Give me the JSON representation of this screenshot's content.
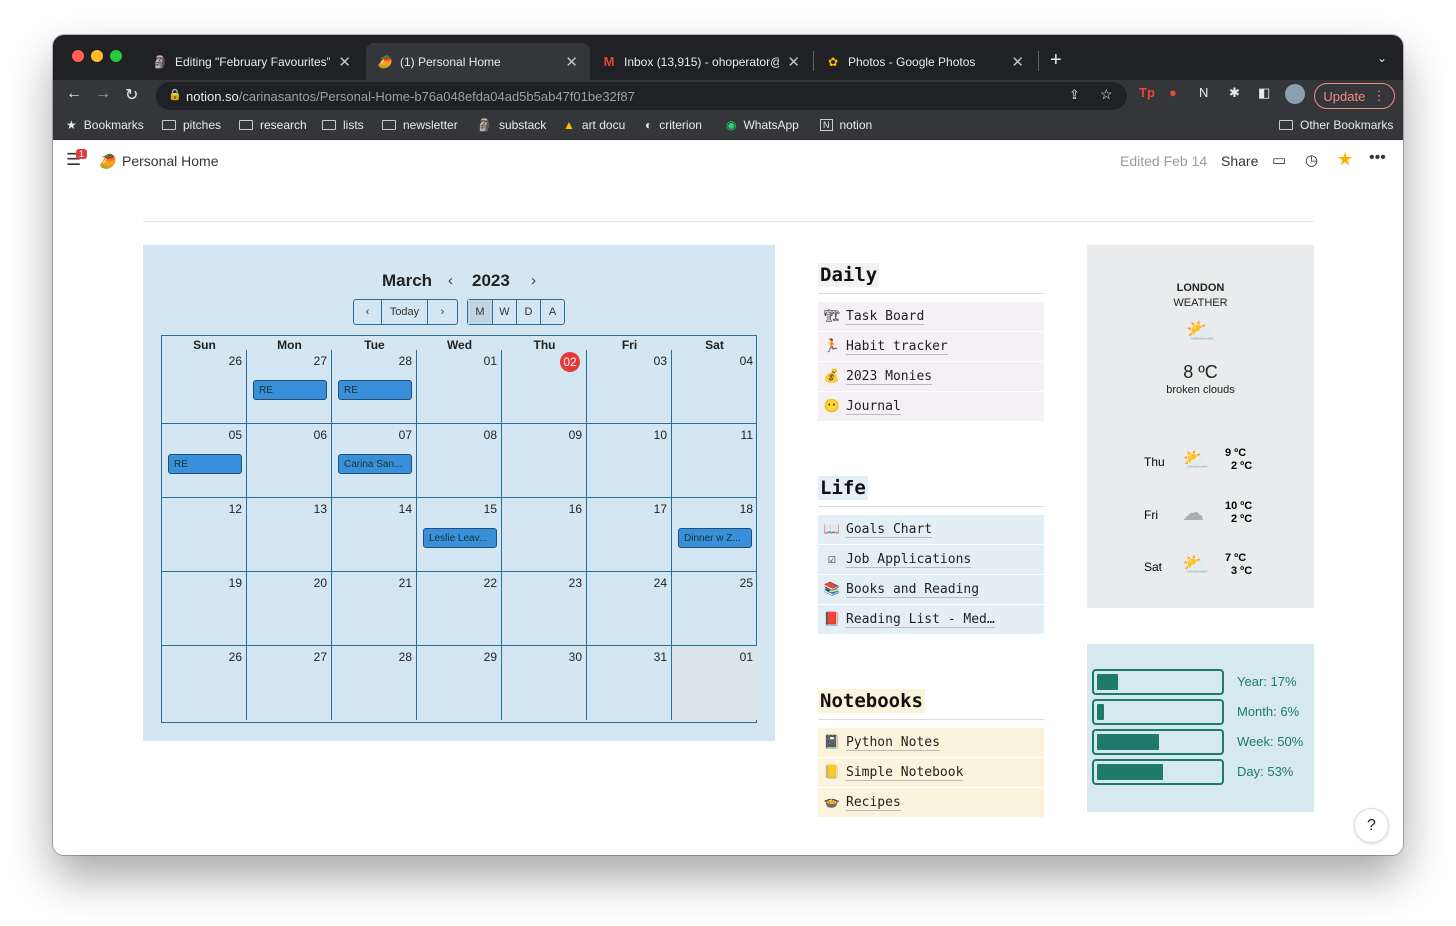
{
  "browser": {
    "tabs": [
      {
        "title": "Editing \"February Favourites\" - ",
        "icon": "substack-icon"
      },
      {
        "title": "(1) Personal Home",
        "icon": "mango-icon"
      },
      {
        "title": "Inbox (13,915) - ohoperator@g",
        "icon": "gmail-icon"
      },
      {
        "title": "Photos - Google Photos",
        "icon": "google-photos-icon"
      }
    ],
    "url_host": "notion.so",
    "url_path": "/carinasantos/Personal-Home-b76a048efda04ad5b5ab47f01be32f87",
    "update_label": "Update",
    "bookmarks": [
      "Bookmarks",
      "pitches",
      "research",
      "lists",
      "newsletter",
      "substack",
      "art docu",
      "criterion",
      "WhatsApp",
      "notion"
    ],
    "other_bookmarks": "Other Bookmarks"
  },
  "notion": {
    "badge": "1",
    "page_title": "Personal Home",
    "edited": "Edited Feb 14",
    "share": "Share"
  },
  "calendar": {
    "month": "March",
    "year": "2023",
    "buttons": {
      "prev": "‹",
      "today": "Today",
      "next": "›",
      "m": "M",
      "w": "W",
      "d": "D",
      "a": "A"
    },
    "days": [
      "Sun",
      "Mon",
      "Tue",
      "Wed",
      "Thu",
      "Fri",
      "Sat"
    ],
    "weeks": [
      [
        "26",
        "27",
        "28",
        "01",
        "02",
        "03",
        "04"
      ],
      [
        "05",
        "06",
        "07",
        "08",
        "09",
        "10",
        "11"
      ],
      [
        "12",
        "13",
        "14",
        "15",
        "16",
        "17",
        "18"
      ],
      [
        "19",
        "20",
        "21",
        "22",
        "23",
        "24",
        "25"
      ],
      [
        "26",
        "27",
        "28",
        "29",
        "30",
        "31",
        "01"
      ]
    ],
    "events": [
      {
        "label": "RE"
      },
      {
        "label": "RE"
      },
      {
        "label": "RE"
      },
      {
        "label": "Carina San..."
      },
      {
        "label": "Leslie Leav..."
      },
      {
        "label": "Dinner w Z..."
      }
    ]
  },
  "sections": [
    {
      "title": "Daily",
      "color": "#f5f0f5",
      "items": [
        {
          "icon": "🏗",
          "label": "Task Board"
        },
        {
          "icon": "🏃",
          "label": "Habit tracker"
        },
        {
          "icon": "💰",
          "label": "2023 Monies"
        },
        {
          "icon": "😶",
          "label": "Journal"
        }
      ]
    },
    {
      "title": "Life",
      "color": "#e4eef5",
      "items": [
        {
          "icon": "📖",
          "label": "Goals Chart"
        },
        {
          "icon": "☑",
          "label": "Job Applications"
        },
        {
          "icon": "📚",
          "label": "Books and Reading"
        },
        {
          "icon": "📕",
          "label": "Reading List - Med…"
        }
      ]
    },
    {
      "title": "Notebooks",
      "color": "#fbf3dc",
      "items": [
        {
          "icon": "📓",
          "label": "Python Notes"
        },
        {
          "icon": "📒",
          "label": "Simple Notebook"
        },
        {
          "icon": "🍲",
          "label": "Recipes"
        }
      ]
    }
  ],
  "weather": {
    "city": "LONDON",
    "label": "WEATHER",
    "temp": "8 ºC",
    "desc": "broken clouds",
    "forecast": [
      {
        "day": "Thu",
        "high": "9 ºC",
        "low": "2 ºC",
        "icon": "cloud-sun-icon"
      },
      {
        "day": "Fri",
        "high": "10 ºC",
        "low": "2 ºC",
        "icon": "cloud-moon-icon"
      },
      {
        "day": "Sat",
        "high": "7 ºC",
        "low": "3 ºC",
        "icon": "cloud-sun-icon"
      }
    ]
  },
  "progress": [
    {
      "label": "Year: 17%",
      "value": 0.17
    },
    {
      "label": "Month: 6%",
      "value": 0.06
    },
    {
      "label": "Week: 50%",
      "value": 0.5
    },
    {
      "label": "Day: 53%",
      "value": 0.53
    }
  ],
  "help": "?"
}
